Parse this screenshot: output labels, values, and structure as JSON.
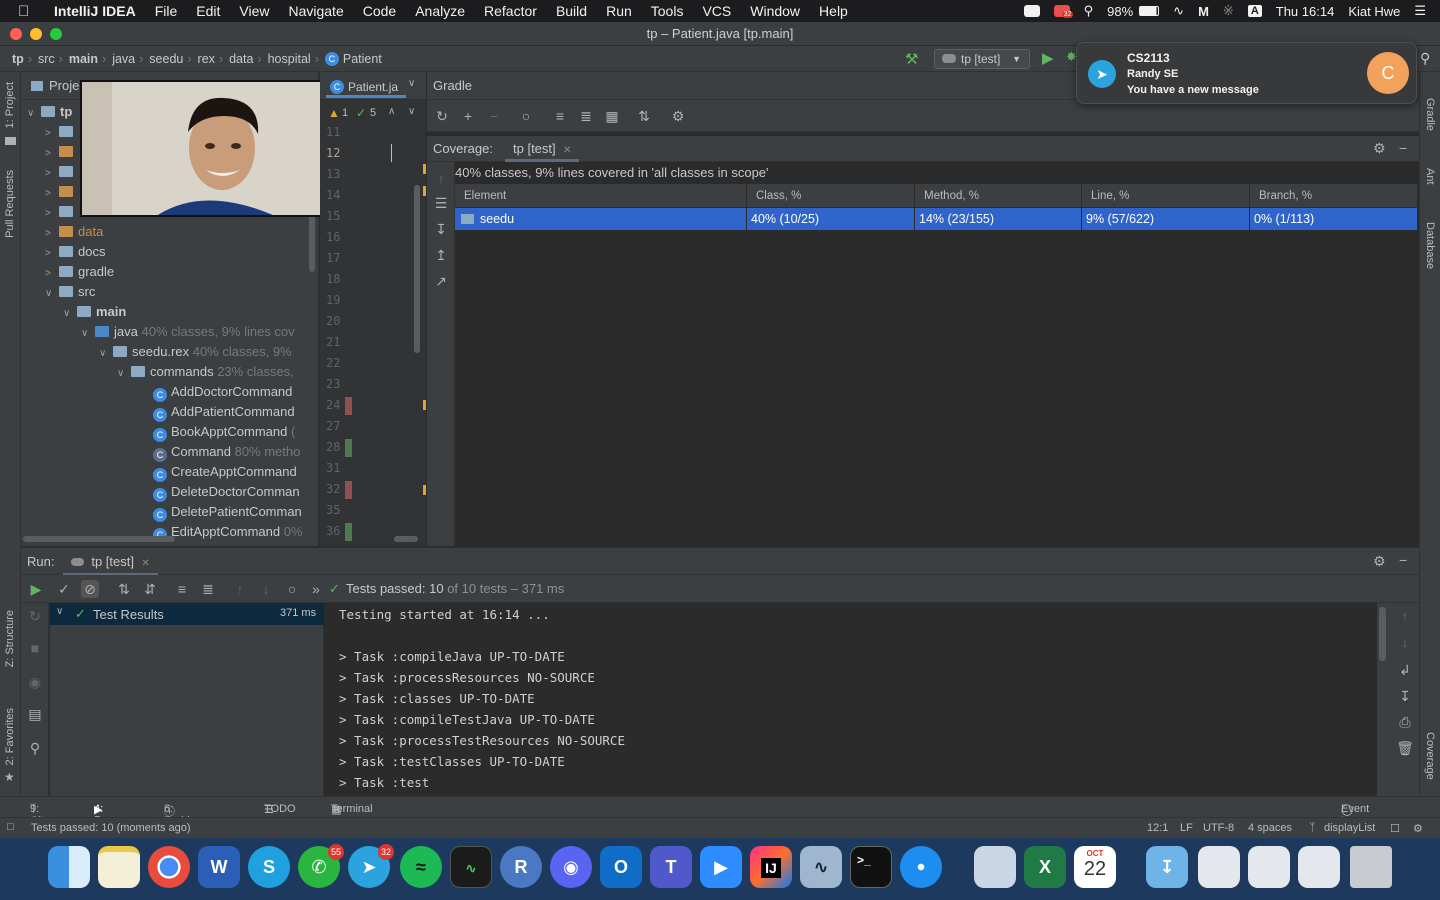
{
  "menubar": {
    "app": "IntelliJ IDEA",
    "items": [
      "File",
      "Edit",
      "View",
      "Navigate",
      "Code",
      "Analyze",
      "Refactor",
      "Build",
      "Run",
      "Tools",
      "VCS",
      "Window",
      "Help"
    ],
    "badge": "32",
    "battery": "98%",
    "input_source": "A",
    "clock": "Thu 16:14",
    "user": "Kiat Hwe"
  },
  "window_title": "tp – Patient.java [tp.main]",
  "breadcrumbs": [
    "tp",
    "src",
    "main",
    "java",
    "seedu",
    "rex",
    "data",
    "hospital",
    "Patient"
  ],
  "run_config": "tp [test]",
  "left_stripe": {
    "project": "1: Project",
    "pull_requests": "Pull Requests",
    "structure": "Z: Structure",
    "favorites": "2: Favorites"
  },
  "right_stripe": {
    "gradle": "Gradle",
    "ant": "Ant",
    "database": "Database",
    "coverage": "Coverage"
  },
  "project": {
    "header": "Proje",
    "root": "tp",
    "rows": [
      {
        "name": "data",
        "hint": ""
      },
      {
        "name": "docs",
        "hint": ""
      },
      {
        "name": "gradle",
        "hint": ""
      },
      {
        "name": "src",
        "hint": ""
      },
      {
        "name": "main",
        "hint": ""
      },
      {
        "name": "java",
        "hint": "40% classes, 9% lines cov"
      },
      {
        "name": "seedu.rex",
        "hint": "40% classes, 9%"
      },
      {
        "name": "commands",
        "hint": "23% classes,"
      },
      {
        "name": "AddDoctorCommand",
        "hint": ""
      },
      {
        "name": "AddPatientCommand",
        "hint": ""
      },
      {
        "name": "BookApptCommand",
        "hint": "("
      },
      {
        "name": "Command",
        "hint": "80% metho"
      },
      {
        "name": "CreateApptCommand",
        "hint": ""
      },
      {
        "name": "DeleteDoctorComman",
        "hint": ""
      },
      {
        "name": "DeletePatientComman",
        "hint": ""
      },
      {
        "name": "EditApptCommand",
        "hint": "0%"
      }
    ]
  },
  "editor": {
    "tab": "Patient.ja",
    "warnings": "1",
    "checks": "5",
    "lines": [
      "11",
      "12",
      "13",
      "14",
      "15",
      "16",
      "17",
      "18",
      "19",
      "20",
      "21",
      "22",
      "23",
      "24",
      "27",
      "28",
      "31",
      "32",
      "35",
      "36"
    ]
  },
  "gradle": {
    "title": "Gradle"
  },
  "coverage": {
    "label": "Coverage:",
    "tab": "tp [test]",
    "summary": "40% classes, 9% lines covered in 'all classes in scope'",
    "columns": [
      "Element",
      "Class, %",
      "Method, %",
      "Line, %",
      "Branch, %"
    ],
    "row": [
      "seedu",
      "40% (10/25)",
      "14% (23/155)",
      "9% (57/622)",
      "0% (1/113)"
    ]
  },
  "notification": {
    "title": "CS2113",
    "sender": "Randy SE",
    "message": "You have a new message",
    "avatar": "C"
  },
  "run": {
    "label": "Run:",
    "tab": "tp [test]",
    "status_passed": "Tests passed: 10",
    "status_rest": "of 10 tests – 371 ms",
    "tree_root": "Test Results",
    "tree_time": "371 ms",
    "console": [
      "Testing started at 16:14 ...",
      "",
      "> Task :compileJava UP-TO-DATE",
      "> Task :processResources NO-SOURCE",
      "> Task :classes UP-TO-DATE",
      "> Task :compileTestJava UP-TO-DATE",
      "> Task :processTestResources NO-SOURCE",
      "> Task :testClasses UP-TO-DATE",
      "> Task :test"
    ]
  },
  "toolwindows": [
    "9: Git",
    "4: Run",
    "6: Problems",
    "TODO",
    "Terminal"
  ],
  "event_log": "Event Log",
  "statusbar": {
    "message": "Tests passed: 10 (moments ago)",
    "position": "12:1",
    "line_sep": "LF",
    "encoding": "UTF-8",
    "indent": "4 spaces",
    "branch": "displayList"
  },
  "dock": {
    "whatsapp_badge": "55",
    "telegram_badge": "32",
    "calendar_month": "OCT",
    "calendar_day": "22"
  },
  "colors": {
    "selection": "#2f65ca",
    "accent": "#4a88c7",
    "pass_green": "#5fb85f",
    "warning": "#e2a52d"
  }
}
